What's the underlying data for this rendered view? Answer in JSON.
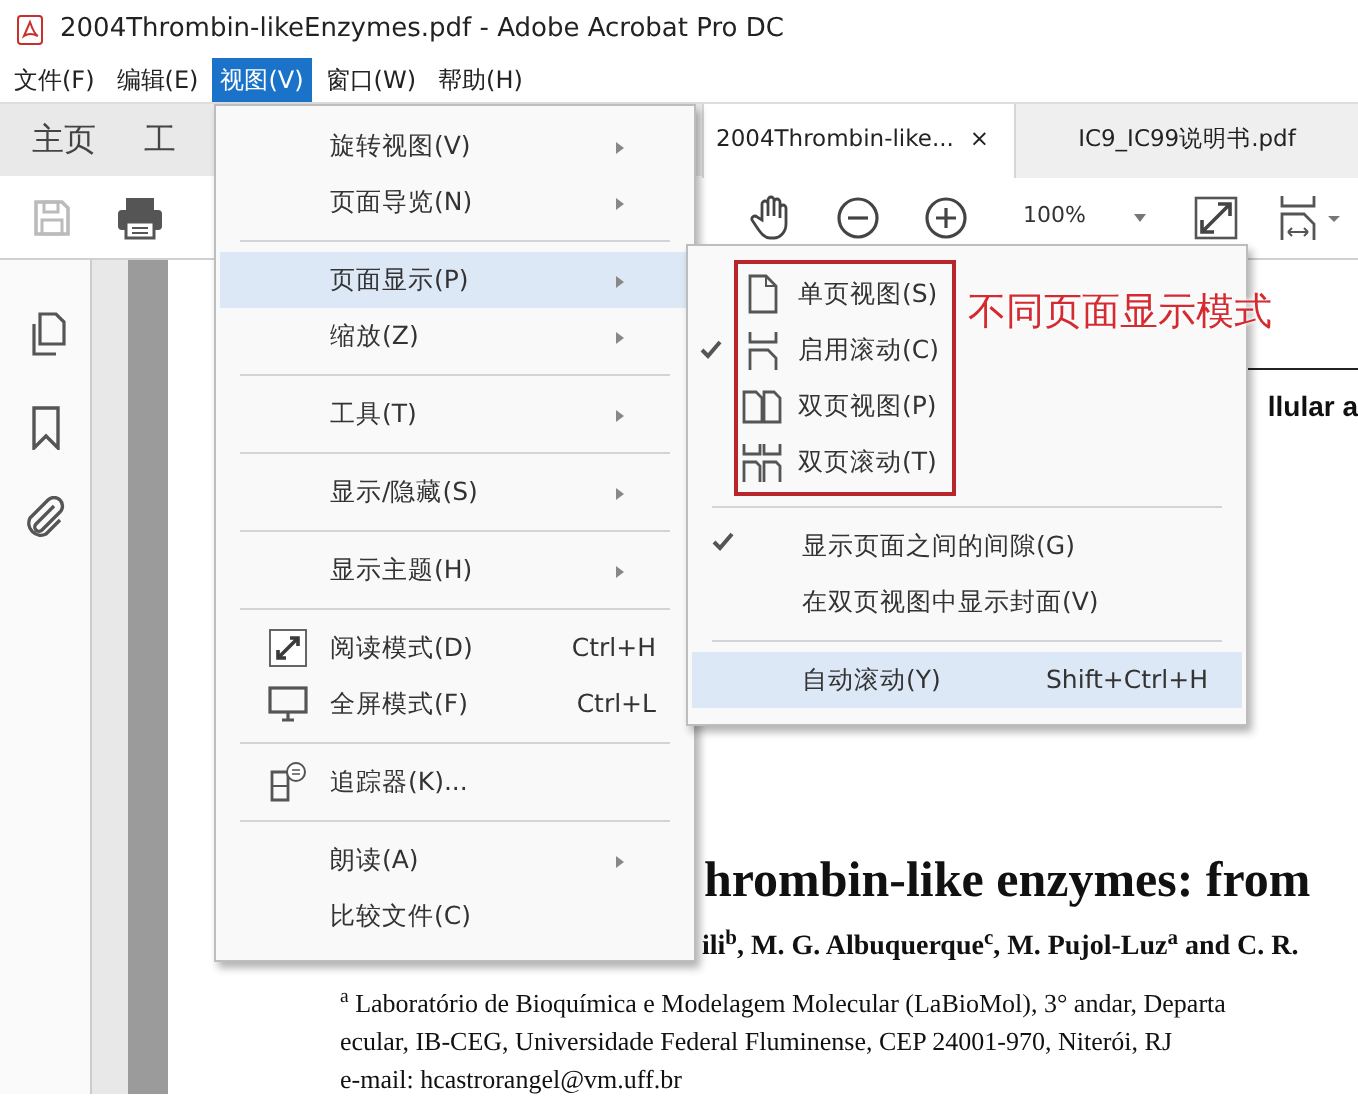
{
  "window": {
    "title": "2004Thrombin-likeEnzymes.pdf - Adobe Acrobat Pro DC"
  },
  "menu_bar": [
    {
      "label": "文件(F)",
      "selected": false
    },
    {
      "label": "编辑(E)",
      "selected": false
    },
    {
      "label": "视图(V)",
      "selected": true
    },
    {
      "label": "窗口(W)",
      "selected": false
    },
    {
      "label": "帮助(H)",
      "selected": false
    }
  ],
  "nav_tabs": [
    {
      "label": "主页"
    },
    {
      "label": "工"
    }
  ],
  "doc_tabs": [
    {
      "label": "2004Thrombin-like...",
      "selected": true,
      "close": "×"
    },
    {
      "label": "IC9_IC99说明书.pdf",
      "selected": false
    }
  ],
  "toolbar": {
    "save_enabled": false,
    "zoom": "100%"
  },
  "view_menu": [
    {
      "kind": "plain",
      "label": "旋转视图(V)",
      "has_submenu": true,
      "selected": false
    },
    {
      "kind": "plain",
      "label": "页面导览(N)",
      "has_submenu": true,
      "selected": false
    },
    {
      "kind": "separator"
    },
    {
      "kind": "plain",
      "label": "页面显示(P)",
      "has_submenu": true,
      "selected": true
    },
    {
      "kind": "plain",
      "label": "缩放(Z)",
      "has_submenu": true,
      "selected": false
    },
    {
      "kind": "separator"
    },
    {
      "kind": "plain",
      "label": "工具(T)",
      "has_submenu": true,
      "selected": false
    },
    {
      "kind": "separator"
    },
    {
      "kind": "plain",
      "label": "显示/隐藏(S)",
      "has_submenu": true,
      "selected": false
    },
    {
      "kind": "separator"
    },
    {
      "kind": "plain",
      "label": "显示主题(H)",
      "has_submenu": true,
      "selected": false
    },
    {
      "kind": "separator"
    },
    {
      "kind": "reading",
      "label": "阅读模式(D)",
      "shortcut": "Ctrl+H",
      "has_submenu": false,
      "selected": false
    },
    {
      "kind": "fullscreen",
      "label": "全屏模式(F)",
      "shortcut": "Ctrl+L",
      "has_submenu": false,
      "selected": false
    },
    {
      "kind": "separator"
    },
    {
      "kind": "tracker",
      "label": "追踪器(K)...",
      "has_submenu": false,
      "selected": false
    },
    {
      "kind": "separator"
    },
    {
      "kind": "plain",
      "label": "朗读(A)",
      "has_submenu": true,
      "selected": false
    },
    {
      "kind": "plain",
      "label": "比较文件(C)",
      "has_submenu": false,
      "selected": false
    }
  ],
  "page_display_menu": [
    {
      "kind": "single",
      "label": "单页视图(S)",
      "checked": false,
      "selected": false
    },
    {
      "kind": "scrolling",
      "label": "启用滚动(C)",
      "checked": true,
      "selected": false
    },
    {
      "kind": "double",
      "label": "双页视图(P)",
      "checked": false,
      "selected": false
    },
    {
      "kind": "doublescroll",
      "label": "双页滚动(T)",
      "checked": false,
      "selected": false
    },
    {
      "kind": "separator"
    },
    {
      "kind": "plain",
      "label": "显示页面之间的间隙(G)",
      "checked": true,
      "selected": false
    },
    {
      "kind": "plain",
      "label": "在双页视图中显示封面(V)",
      "checked": false,
      "selected": false
    },
    {
      "kind": "separator"
    },
    {
      "kind": "plain",
      "label": "自动滚动(Y)",
      "shortcut": "Shift+Ctrl+H",
      "checked": false,
      "selected": true
    }
  ],
  "annotation": {
    "label": "不同页面显示模式"
  },
  "document": {
    "heading_fragment": "llular a",
    "title": "hrombin-like enzymes: from",
    "authors": "ili$^{b}$, M. G. Albuquerque$^{c}$, M. Pujol-Luz$^{a}$ and C. R.",
    "affiliation_lines": [
      "$^{a}$ Laboratório de Bioquímica e Modelagem Molecular (LaBioMol), 3° andar, Departa",
      "ecular, IB-CEG, Universidade Federal Fluminense, CEP 24001-970, Niterói, RJ",
      "e-mail: hcastrorangel@vm.uff.br"
    ]
  }
}
